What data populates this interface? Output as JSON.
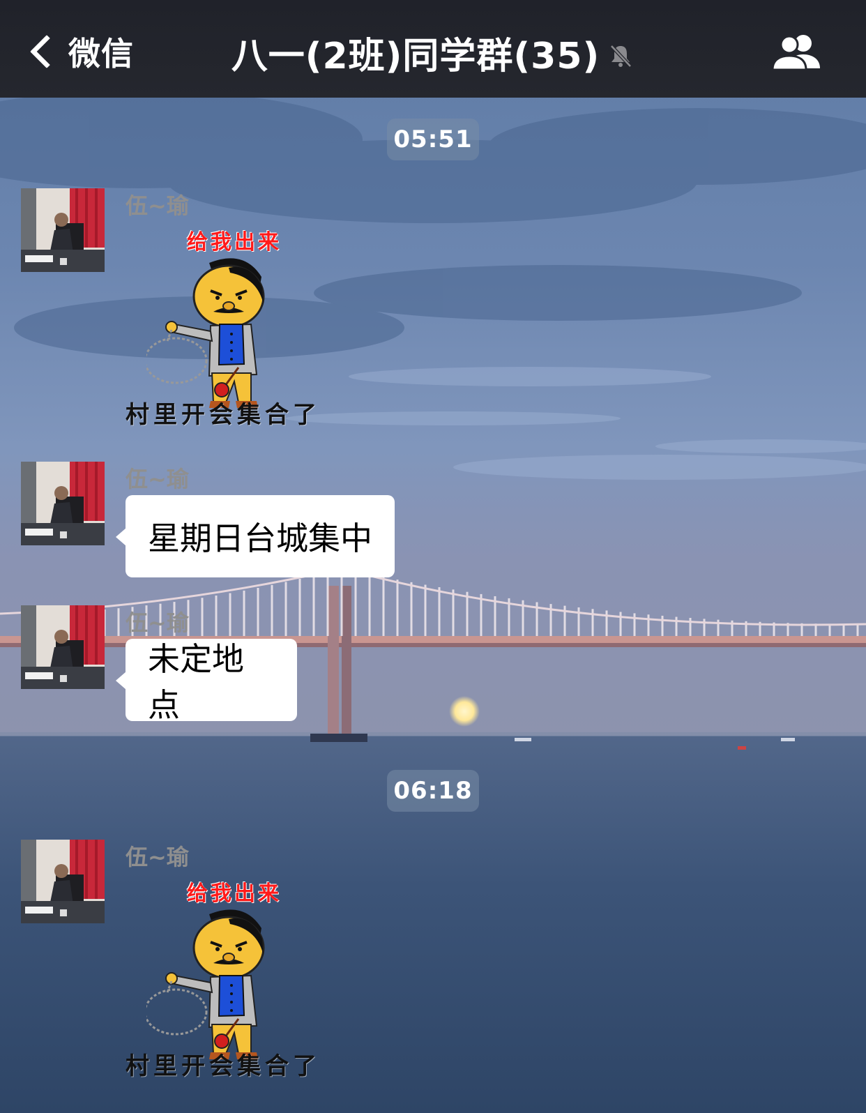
{
  "nav": {
    "back_label": "微信",
    "title": "八一(2班)同学群(35)",
    "mute_icon": "bell-slash-icon",
    "members_icon": "group-members-icon"
  },
  "colors": {
    "navbar": "#22242b",
    "bubble": "#ffffff",
    "sticker_top_text": "#ff1a1a"
  },
  "messages": [
    {
      "type": "timestamp",
      "text": "05:51"
    },
    {
      "type": "sticker",
      "sender": "伍~瑜",
      "top_text": "给我出来",
      "bottom_text": "村里开会集合了"
    },
    {
      "type": "text",
      "sender": "伍~瑜",
      "text": "星期日台城集中"
    },
    {
      "type": "text",
      "sender": "伍~瑜",
      "text": "未定地点"
    },
    {
      "type": "timestamp",
      "text": "06:18"
    },
    {
      "type": "sticker",
      "sender": "伍~瑜",
      "top_text": "给我出来",
      "bottom_text": "村里开会集合了"
    }
  ]
}
